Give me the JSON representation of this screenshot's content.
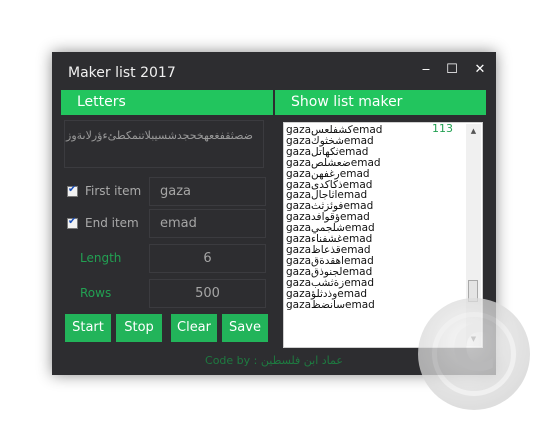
{
  "window": {
    "title": "Maker list 2017",
    "minimize_glyph": "‒",
    "maximize_glyph": "☐",
    "close_glyph": "✕"
  },
  "letters_panel": {
    "header": "Letters",
    "letters": "ضصثقفغعهخحجدشسيبلاتنمكطئءؤرلاىةوز"
  },
  "options": {
    "first_item": {
      "label": "First item",
      "checked": true,
      "value": "gaza"
    },
    "end_item": {
      "label": "End item",
      "checked": true,
      "value": "emad"
    },
    "length": {
      "label": "Length",
      "value": "6"
    },
    "rows": {
      "label": "Rows",
      "value": "500"
    }
  },
  "buttons": {
    "start": "Start",
    "stop": "Stop",
    "clear": "Clear",
    "save": "Save"
  },
  "list_panel": {
    "header": "Show list maker",
    "count": "113",
    "items": [
      "gazaكشفلعسemad",
      "gazaشخثوكemad",
      "gazaثكهاتلemad",
      "gazaضعشلصemad",
      "gazaرغفهنemad",
      "gazaذكاكدىemad",
      "gazaاثاجالemad",
      "gazaفوئزثثemad",
      "gazaؤقوافدemad",
      "gazaشلجميemad",
      "gazaغشفناءemad",
      "gazaقذعاظemad",
      "gazaاهقدةقemad",
      "gazaلجنوذقemad",
      "gazaزةثشبemad",
      "gazaوذدثلؤemad",
      "gazaسانضظemad"
    ]
  },
  "footer": "Code by : عماد ابن فلسطين",
  "colors": {
    "accent": "#22c55e",
    "window_bg": "#2d2d30",
    "footer_text": "#1e7a40"
  }
}
